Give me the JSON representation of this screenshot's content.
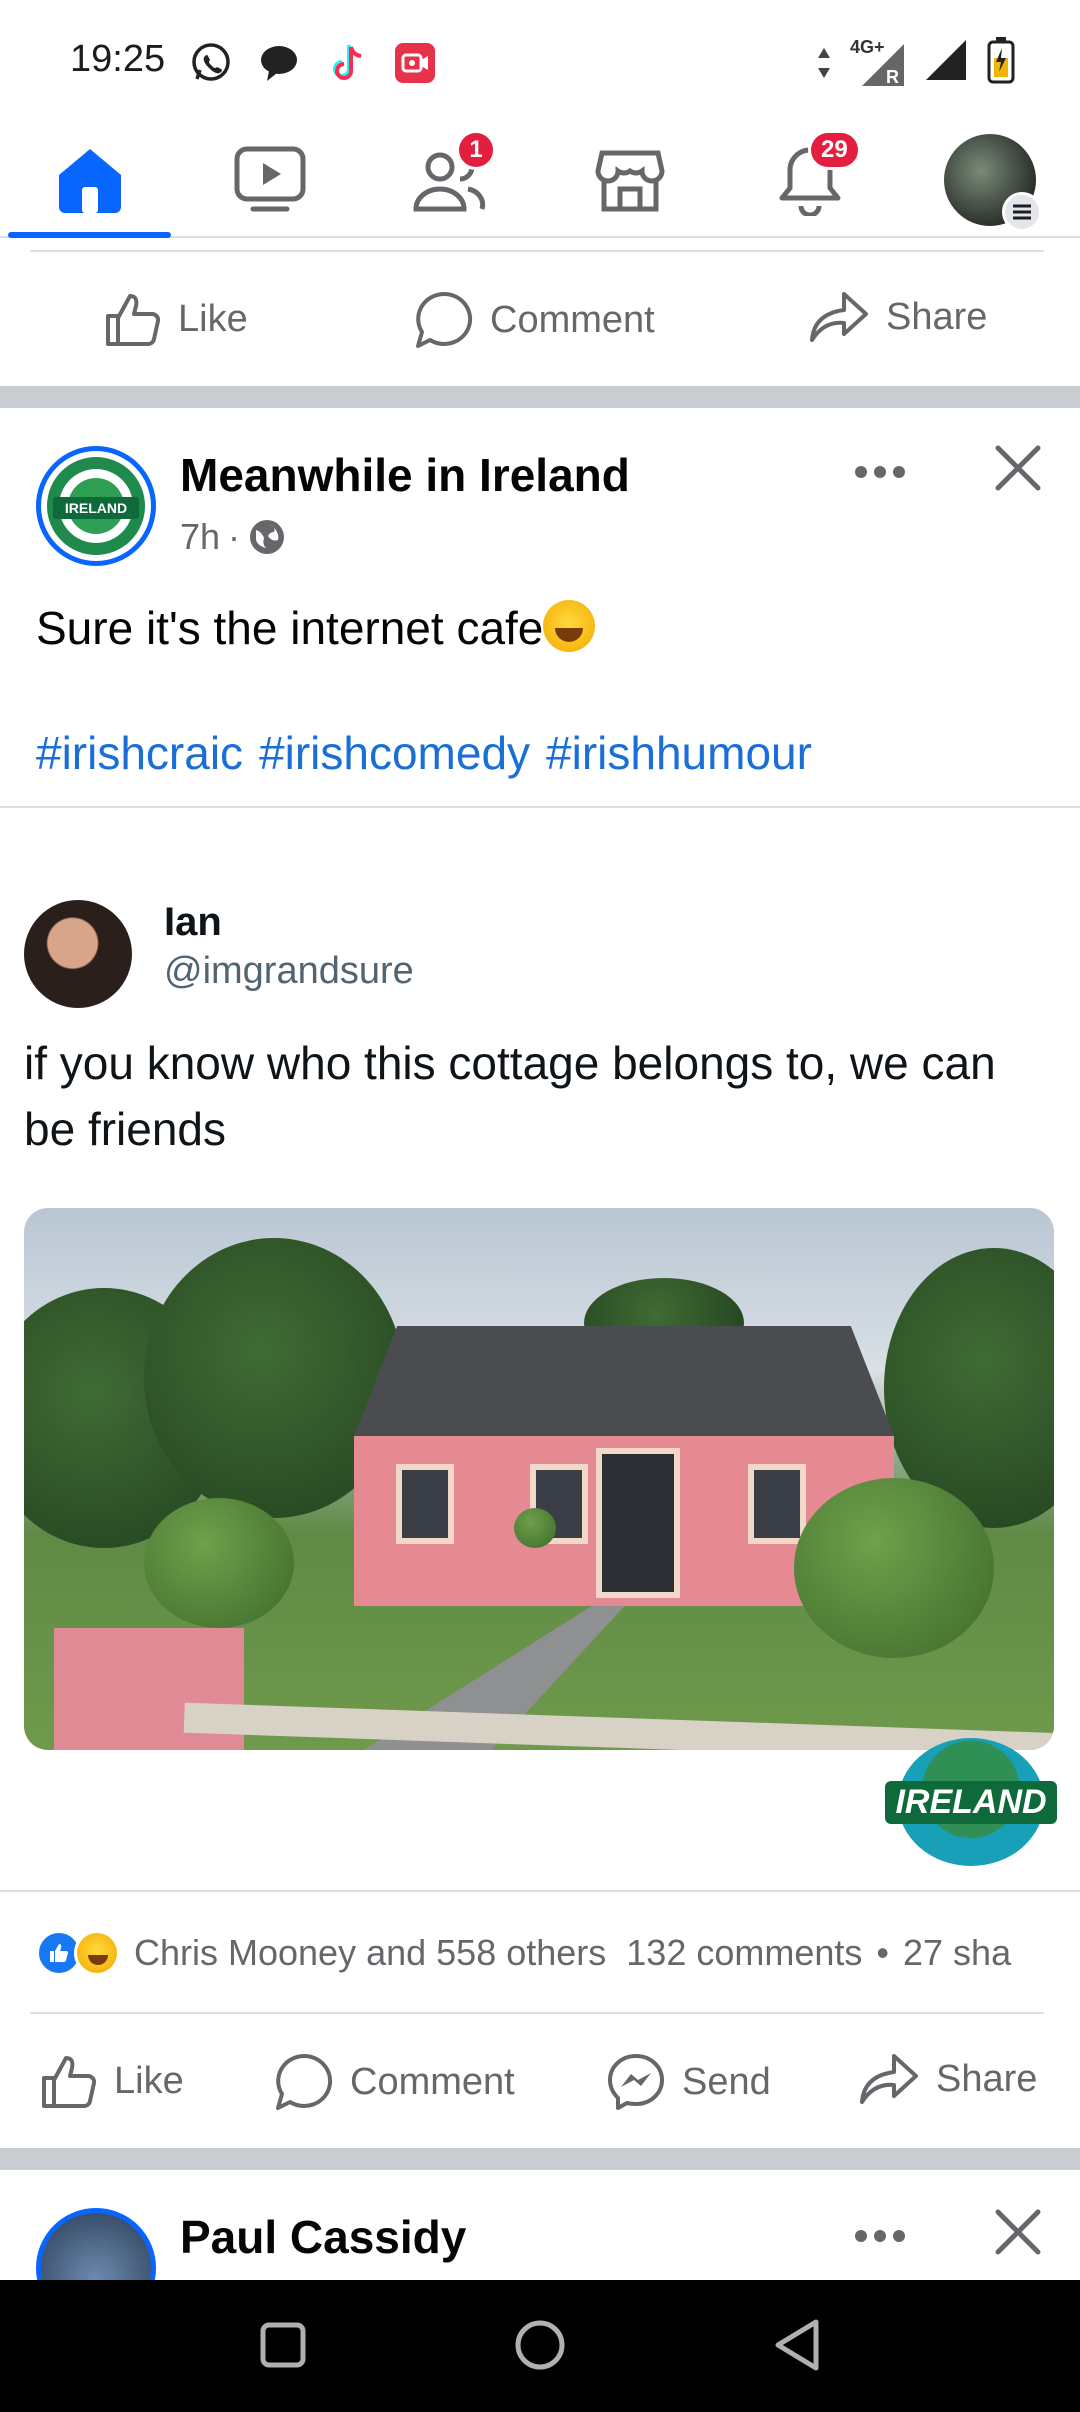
{
  "status_bar": {
    "time": "19:25",
    "network": "4G+",
    "roaming": "R",
    "left_icons": [
      "whatsapp-icon",
      "messages-icon",
      "tiktok-icon",
      "screen-recorder-icon"
    ],
    "right_icons": [
      "data-arrows-icon",
      "signal-icon",
      "battery-icon"
    ]
  },
  "top_nav": {
    "tabs": [
      {
        "name": "home",
        "icon": "home-icon",
        "active": true
      },
      {
        "name": "video",
        "icon": "video-icon"
      },
      {
        "name": "friends",
        "icon": "friends-icon",
        "badge": "1"
      },
      {
        "name": "marketplace",
        "icon": "marketplace-icon"
      },
      {
        "name": "notifications",
        "icon": "bell-icon",
        "badge": "29"
      },
      {
        "name": "profile",
        "icon": "avatar-icon"
      }
    ],
    "colors": {
      "active": "#0866ff",
      "badge": "#e41e3f"
    }
  },
  "prev_post_actions": {
    "like": "Like",
    "comment": "Comment",
    "share": "Share"
  },
  "post": {
    "author": "Meanwhile in Ireland",
    "time": "7h",
    "separator": "·",
    "privacy_icon": "globe-icon",
    "text": "Sure it's the internet cafe",
    "hashtags": [
      "#irishcraic",
      "#irishcomedy",
      "#irishhumour"
    ],
    "avatar_text": "IRELAND",
    "embedded_tweet": {
      "name": "Ian",
      "handle": "@imgrandsure",
      "text": "if you know who this cottage belongs to, we can be friends"
    },
    "watermark_text": "IRELAND",
    "reactions_summary": "Chris Mooney and 558 others",
    "comments": "132 comments",
    "shares_bullet": "•",
    "shares": "27 sha",
    "actions": {
      "like": "Like",
      "comment": "Comment",
      "send": "Send",
      "share": "Share"
    }
  },
  "next_post": {
    "author": "Paul Cassidy"
  },
  "colors": {
    "link": "#1a6ed8",
    "secondary_text": "#65676b",
    "separator": "#c9ccd1"
  }
}
